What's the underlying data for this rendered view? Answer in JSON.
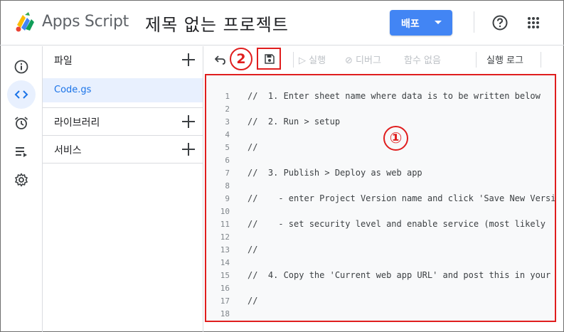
{
  "header": {
    "app_name": "Apps Script",
    "project_title": "제목 없는 프로젝트",
    "deploy_label": "배포",
    "logo_icon": "apps-script-logo-icon",
    "help_icon": "help-icon",
    "apps_icon": "apps-grid-icon"
  },
  "rail": {
    "items": [
      {
        "name": "info-icon",
        "active": false
      },
      {
        "name": "code-icon",
        "active": true
      },
      {
        "name": "alarm-icon",
        "active": false
      },
      {
        "name": "executions-icon",
        "active": false
      },
      {
        "name": "settings-icon",
        "active": false
      }
    ]
  },
  "files": {
    "files_label": "파일",
    "active_file": "Code.gs",
    "libraries_label": "라이브러리",
    "services_label": "서비스"
  },
  "toolbar": {
    "run_label": "▷ 실행",
    "debug_label": "⊘ 디버그",
    "function_label": "함수 없음",
    "log_label": "실행 로그"
  },
  "annotations": {
    "badge_editor": "①",
    "badge_save": "2"
  },
  "code": {
    "lines": [
      {
        "n": "1",
        "t": "//  1. Enter sheet name where data is to be written below"
      },
      {
        "n": "2",
        "t": ""
      },
      {
        "n": "3",
        "t": "//  2. Run > setup"
      },
      {
        "n": "4",
        "t": ""
      },
      {
        "n": "5",
        "t": "//"
      },
      {
        "n": "6",
        "t": ""
      },
      {
        "n": "7",
        "t": "//  3. Publish > Deploy as web app"
      },
      {
        "n": "8",
        "t": ""
      },
      {
        "n": "9",
        "t": "//    - enter Project Version name and click 'Save New Version'"
      },
      {
        "n": "10",
        "t": ""
      },
      {
        "n": "11",
        "t": "//    - set security level and enable service (most likely"
      },
      {
        "n": "12",
        "t": ""
      },
      {
        "n": "13",
        "t": "//"
      },
      {
        "n": "14",
        "t": ""
      },
      {
        "n": "15",
        "t": "//  4. Copy the 'Current web app URL' and post this in your"
      },
      {
        "n": "16",
        "t": ""
      },
      {
        "n": "17",
        "t": "//"
      },
      {
        "n": "18",
        "t": ""
      }
    ]
  },
  "colors": {
    "accent": "#4285f4",
    "annotation_red": "#e01e1e",
    "active_file_bg": "#e8f0fe",
    "active_file_text": "#1a73e8"
  }
}
